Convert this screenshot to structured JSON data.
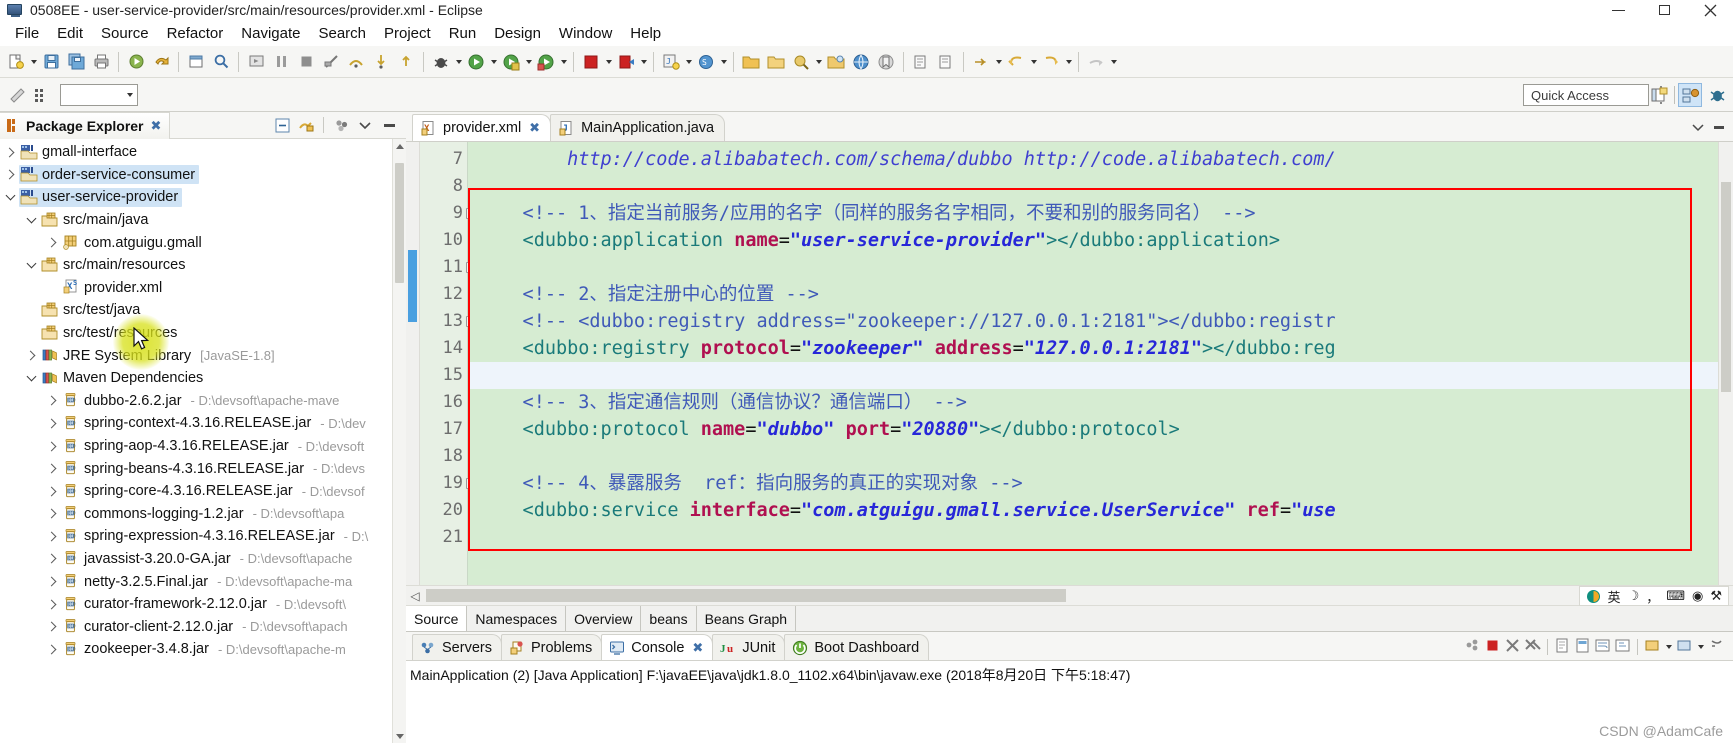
{
  "window": {
    "title": "0508EE - user-service-provider/src/main/resources/provider.xml - Eclipse",
    "minimize": "—",
    "maximize": "❐",
    "close": "✕"
  },
  "menubar": {
    "items": [
      "File",
      "Edit",
      "Source",
      "Refactor",
      "Navigate",
      "Search",
      "Project",
      "Run",
      "Design",
      "Window",
      "Help"
    ]
  },
  "toolbar": {
    "quick_access_placeholder": "Quick Access"
  },
  "package_explorer": {
    "tab_label": "Package Explorer",
    "close_label": "✖",
    "tree": [
      {
        "label": "gmall-interface",
        "sub": "",
        "depth": 0,
        "state": "collapsed",
        "icon": "project-icon",
        "selected": false
      },
      {
        "label": "order-service-consumer",
        "sub": "",
        "depth": 0,
        "state": "collapsed",
        "icon": "project-icon",
        "selected": true
      },
      {
        "label": "user-service-provider",
        "sub": "",
        "depth": 0,
        "state": "expanded",
        "icon": "project-icon",
        "selected": true
      },
      {
        "label": "src/main/java",
        "sub": "",
        "depth": 1,
        "state": "expanded",
        "icon": "source-folder-icon",
        "selected": false
      },
      {
        "label": "com.atguigu.gmall",
        "sub": "",
        "depth": 2,
        "state": "collapsed",
        "icon": "package-icon",
        "selected": false
      },
      {
        "label": "src/main/resources",
        "sub": "",
        "depth": 1,
        "state": "expanded",
        "icon": "source-folder-icon",
        "selected": false
      },
      {
        "label": "provider.xml",
        "sub": "",
        "depth": 2,
        "state": "none",
        "icon": "xml-file-icon",
        "selected": false
      },
      {
        "label": "src/test/java",
        "sub": "",
        "depth": 1,
        "state": "none",
        "icon": "source-folder-icon",
        "selected": false
      },
      {
        "label": "src/test/resources",
        "sub": "",
        "depth": 1,
        "state": "none",
        "icon": "source-folder-icon",
        "selected": false
      },
      {
        "label": "JRE System Library",
        "sub": "[JavaSE-1.8]",
        "depth": 1,
        "state": "collapsed",
        "icon": "library-icon",
        "selected": false
      },
      {
        "label": "Maven Dependencies",
        "sub": "",
        "depth": 1,
        "state": "expanded",
        "icon": "library-icon",
        "selected": false
      },
      {
        "label": "dubbo-2.6.2.jar",
        "sub": "- D:\\devsoft\\apache-mave",
        "depth": 2,
        "state": "collapsed",
        "icon": "jar-icon",
        "selected": false
      },
      {
        "label": "spring-context-4.3.16.RELEASE.jar",
        "sub": "- D:\\dev",
        "depth": 2,
        "state": "collapsed",
        "icon": "jar-icon",
        "selected": false
      },
      {
        "label": "spring-aop-4.3.16.RELEASE.jar",
        "sub": "- D:\\devsoft",
        "depth": 2,
        "state": "collapsed",
        "icon": "jar-icon",
        "selected": false
      },
      {
        "label": "spring-beans-4.3.16.RELEASE.jar",
        "sub": "- D:\\devs",
        "depth": 2,
        "state": "collapsed",
        "icon": "jar-icon",
        "selected": false
      },
      {
        "label": "spring-core-4.3.16.RELEASE.jar",
        "sub": "- D:\\devsof",
        "depth": 2,
        "state": "collapsed",
        "icon": "jar-icon",
        "selected": false
      },
      {
        "label": "commons-logging-1.2.jar",
        "sub": "- D:\\devsoft\\apa",
        "depth": 2,
        "state": "collapsed",
        "icon": "jar-icon",
        "selected": false
      },
      {
        "label": "spring-expression-4.3.16.RELEASE.jar",
        "sub": "- D:\\",
        "depth": 2,
        "state": "collapsed",
        "icon": "jar-icon",
        "selected": false
      },
      {
        "label": "javassist-3.20.0-GA.jar",
        "sub": "- D:\\devsoft\\apache",
        "depth": 2,
        "state": "collapsed",
        "icon": "jar-icon",
        "selected": false
      },
      {
        "label": "netty-3.2.5.Final.jar",
        "sub": "- D:\\devsoft\\apache-ma",
        "depth": 2,
        "state": "collapsed",
        "icon": "jar-icon",
        "selected": false
      },
      {
        "label": "curator-framework-2.12.0.jar",
        "sub": "- D:\\devsoft\\",
        "depth": 2,
        "state": "collapsed",
        "icon": "jar-icon",
        "selected": false
      },
      {
        "label": "curator-client-2.12.0.jar",
        "sub": "- D:\\devsoft\\apach",
        "depth": 2,
        "state": "collapsed",
        "icon": "jar-icon",
        "selected": false
      },
      {
        "label": "zookeeper-3.4.8.jar",
        "sub": "- D:\\devsoft\\apache-m",
        "depth": 2,
        "state": "collapsed",
        "icon": "jar-icon",
        "selected": false
      }
    ]
  },
  "editor": {
    "tabs": [
      {
        "label": "provider.xml",
        "icon": "xml-file-icon",
        "active": true,
        "close": "✖"
      },
      {
        "label": "MainApplication.java",
        "icon": "java-file-icon",
        "active": false,
        "close": ""
      }
    ],
    "lines": [
      {
        "no": "7",
        "fold": false,
        "current": false,
        "segments": [
          {
            "t": "scroll",
            "s": "        http://code.alibabatech.com/schema/dubbo http://code.alibabatech.com/"
          }
        ]
      },
      {
        "no": "8",
        "fold": false,
        "current": false,
        "segments": []
      },
      {
        "no": "9",
        "fold": true,
        "current": false,
        "segments": [
          {
            "t": "comment",
            "s": "    <!-- 1、指定当前服务/应用的名字（同样的服务名字相同，不要和别的服务同名） -->"
          }
        ]
      },
      {
        "no": "10",
        "fold": false,
        "current": false,
        "segments": [
          {
            "t": "tag",
            "s": "    <dubbo:application "
          },
          {
            "t": "attr",
            "s": "name"
          },
          {
            "t": "eq",
            "s": "="
          },
          {
            "t": "val",
            "s": "\"user-service-provider\""
          },
          {
            "t": "tag",
            "s": "></dubbo:application>"
          }
        ]
      },
      {
        "no": "11",
        "fold": true,
        "current": false,
        "segments": []
      },
      {
        "no": "12",
        "fold": false,
        "current": false,
        "segments": [
          {
            "t": "comment",
            "s": "    <!-- 2、指定注册中心的位置 -->"
          }
        ]
      },
      {
        "no": "13",
        "fold": true,
        "current": false,
        "segments": [
          {
            "t": "comment",
            "s": "    <!-- <dubbo:registry address=\"zookeeper://127.0.0.1:2181\"></dubbo:registr"
          }
        ]
      },
      {
        "no": "14",
        "fold": false,
        "current": false,
        "segments": [
          {
            "t": "tag",
            "s": "    <dubbo:registry "
          },
          {
            "t": "attr",
            "s": "protocol"
          },
          {
            "t": "eq",
            "s": "="
          },
          {
            "t": "val",
            "s": "\"zookeeper\""
          },
          {
            "t": "plain",
            "s": " "
          },
          {
            "t": "attr",
            "s": "address"
          },
          {
            "t": "eq",
            "s": "="
          },
          {
            "t": "val",
            "s": "\"127.0.0.1:2181\""
          },
          {
            "t": "tag",
            "s": "></dubbo:reg"
          }
        ]
      },
      {
        "no": "15",
        "fold": false,
        "current": true,
        "segments": []
      },
      {
        "no": "16",
        "fold": false,
        "current": false,
        "segments": [
          {
            "t": "comment",
            "s": "    <!-- 3、指定通信规则（通信协议？通信端口） -->"
          }
        ]
      },
      {
        "no": "17",
        "fold": false,
        "current": false,
        "segments": [
          {
            "t": "tag",
            "s": "    <dubbo:protocol "
          },
          {
            "t": "attr",
            "s": "name"
          },
          {
            "t": "eq",
            "s": "="
          },
          {
            "t": "val",
            "s": "\"dubbo\""
          },
          {
            "t": "plain",
            "s": " "
          },
          {
            "t": "attr",
            "s": "port"
          },
          {
            "t": "eq",
            "s": "="
          },
          {
            "t": "val",
            "s": "\"20880\""
          },
          {
            "t": "tag",
            "s": "></dubbo:protocol>"
          }
        ]
      },
      {
        "no": "18",
        "fold": false,
        "current": false,
        "segments": []
      },
      {
        "no": "19",
        "fold": true,
        "current": false,
        "segments": [
          {
            "t": "comment",
            "s": "    <!-- 4、暴露服务  ref：指向服务的真正的实现对象 -->"
          }
        ]
      },
      {
        "no": "20",
        "fold": false,
        "current": false,
        "segments": [
          {
            "t": "tag",
            "s": "    <dubbo:service "
          },
          {
            "t": "attr",
            "s": "interface"
          },
          {
            "t": "eq",
            "s": "="
          },
          {
            "t": "val",
            "s": "\"com.atguigu.gmall.service.UserService\""
          },
          {
            "t": "plain",
            "s": " "
          },
          {
            "t": "attr",
            "s": "ref"
          },
          {
            "t": "eq",
            "s": "="
          },
          {
            "t": "val",
            "s": "\"use"
          }
        ]
      },
      {
        "no": "21",
        "fold": false,
        "current": false,
        "segments": []
      }
    ],
    "form_tabs": [
      "Source",
      "Namespaces",
      "Overview",
      "beans",
      "Beans Graph"
    ],
    "active_form_tab": "Source",
    "ime": {
      "lang": "英",
      "moon": "☽",
      "comma": "，",
      "keyboard": "⌨",
      "user": "◉",
      "tool": "⚒"
    }
  },
  "console": {
    "tabs": [
      {
        "label": "Servers",
        "icon": "servers-icon",
        "active": false
      },
      {
        "label": "Problems",
        "icon": "problems-icon",
        "active": false
      },
      {
        "label": "Console",
        "icon": "console-icon",
        "active": true,
        "close": "✖"
      },
      {
        "label": "JUnit",
        "icon": "junit-icon",
        "active": false
      },
      {
        "label": "Boot Dashboard",
        "icon": "boot-dashboard-icon",
        "active": false
      }
    ],
    "output": "MainApplication (2) [Java Application] F:\\javaEE\\java\\jdk1.8.0_1102.x64\\bin\\javaw.exe (2018年8月20日 下午5:18:47)"
  },
  "watermark": "CSDN @AdamCafe",
  "colors": {
    "editor_bg": "#d6ecd2",
    "tree_selection": "#cfe3f5",
    "red_box": "#ff0000",
    "comment": "#3f59b8",
    "tag": "#1a7a7a",
    "attr": "#b01050",
    "value": "#2727d8"
  }
}
